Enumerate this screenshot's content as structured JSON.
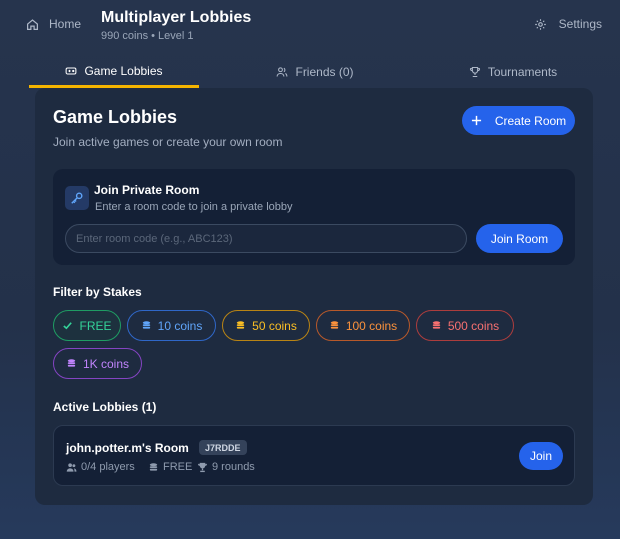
{
  "header": {
    "home_label": "Home",
    "title": "Multiplayer Lobbies",
    "subtitle": "990 coins • Level 1",
    "settings_label": "Settings"
  },
  "tabs": [
    {
      "label": "Game Lobbies",
      "active": true
    },
    {
      "label": "Friends (0)",
      "active": false
    },
    {
      "label": "Tournaments",
      "active": false
    }
  ],
  "panel": {
    "title": "Game Lobbies",
    "subtitle": "Join active games or create your own room",
    "create_label": "Create Room"
  },
  "private_room": {
    "title": "Join Private Room",
    "subtitle": "Enter a room code to join a private lobby",
    "input_placeholder": "Enter room code (e.g., ABC123)",
    "input_value": "",
    "join_label": "Join Room"
  },
  "filters": {
    "label": "Filter by Stakes",
    "chips": [
      {
        "label": "FREE",
        "color": "#34d399",
        "selected": true
      },
      {
        "label": "10 coins",
        "color": "#60a5fa",
        "selected": false
      },
      {
        "label": "50 coins",
        "color": "#fbbf24",
        "selected": false
      },
      {
        "label": "100 coins",
        "color": "#fb923c",
        "selected": false
      },
      {
        "label": "500 coins",
        "color": "#f87171",
        "selected": false
      },
      {
        "label": "1K coins",
        "color": "#c084fc",
        "selected": false
      }
    ]
  },
  "active_lobbies": {
    "label": "Active Lobbies (1)",
    "items": [
      {
        "name": "john.potter.m's Room",
        "code": "J7RDDE",
        "players": "0/4 players",
        "stake": "FREE",
        "rounds": "9 rounds",
        "join_label": "Join"
      }
    ]
  },
  "colors": {
    "accent": "#2563eb",
    "tab_underline": "#f4b400",
    "panel_bg": "#1e2b40"
  }
}
